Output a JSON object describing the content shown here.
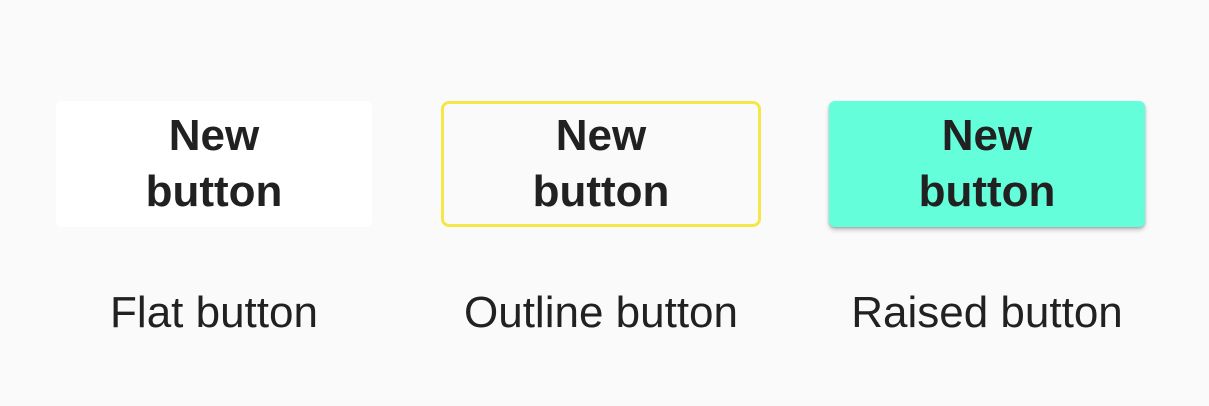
{
  "buttons": [
    {
      "label": "New button",
      "caption": "Flat button"
    },
    {
      "label": "New button",
      "caption": "Outline button"
    },
    {
      "label": "New button",
      "caption": "Raised button"
    }
  ],
  "colors": {
    "background": "#fafafa",
    "flat_fill": "#ffffff",
    "outline_border": "#f5e64a",
    "raised_fill": "#64ffda",
    "text": "#212121"
  }
}
